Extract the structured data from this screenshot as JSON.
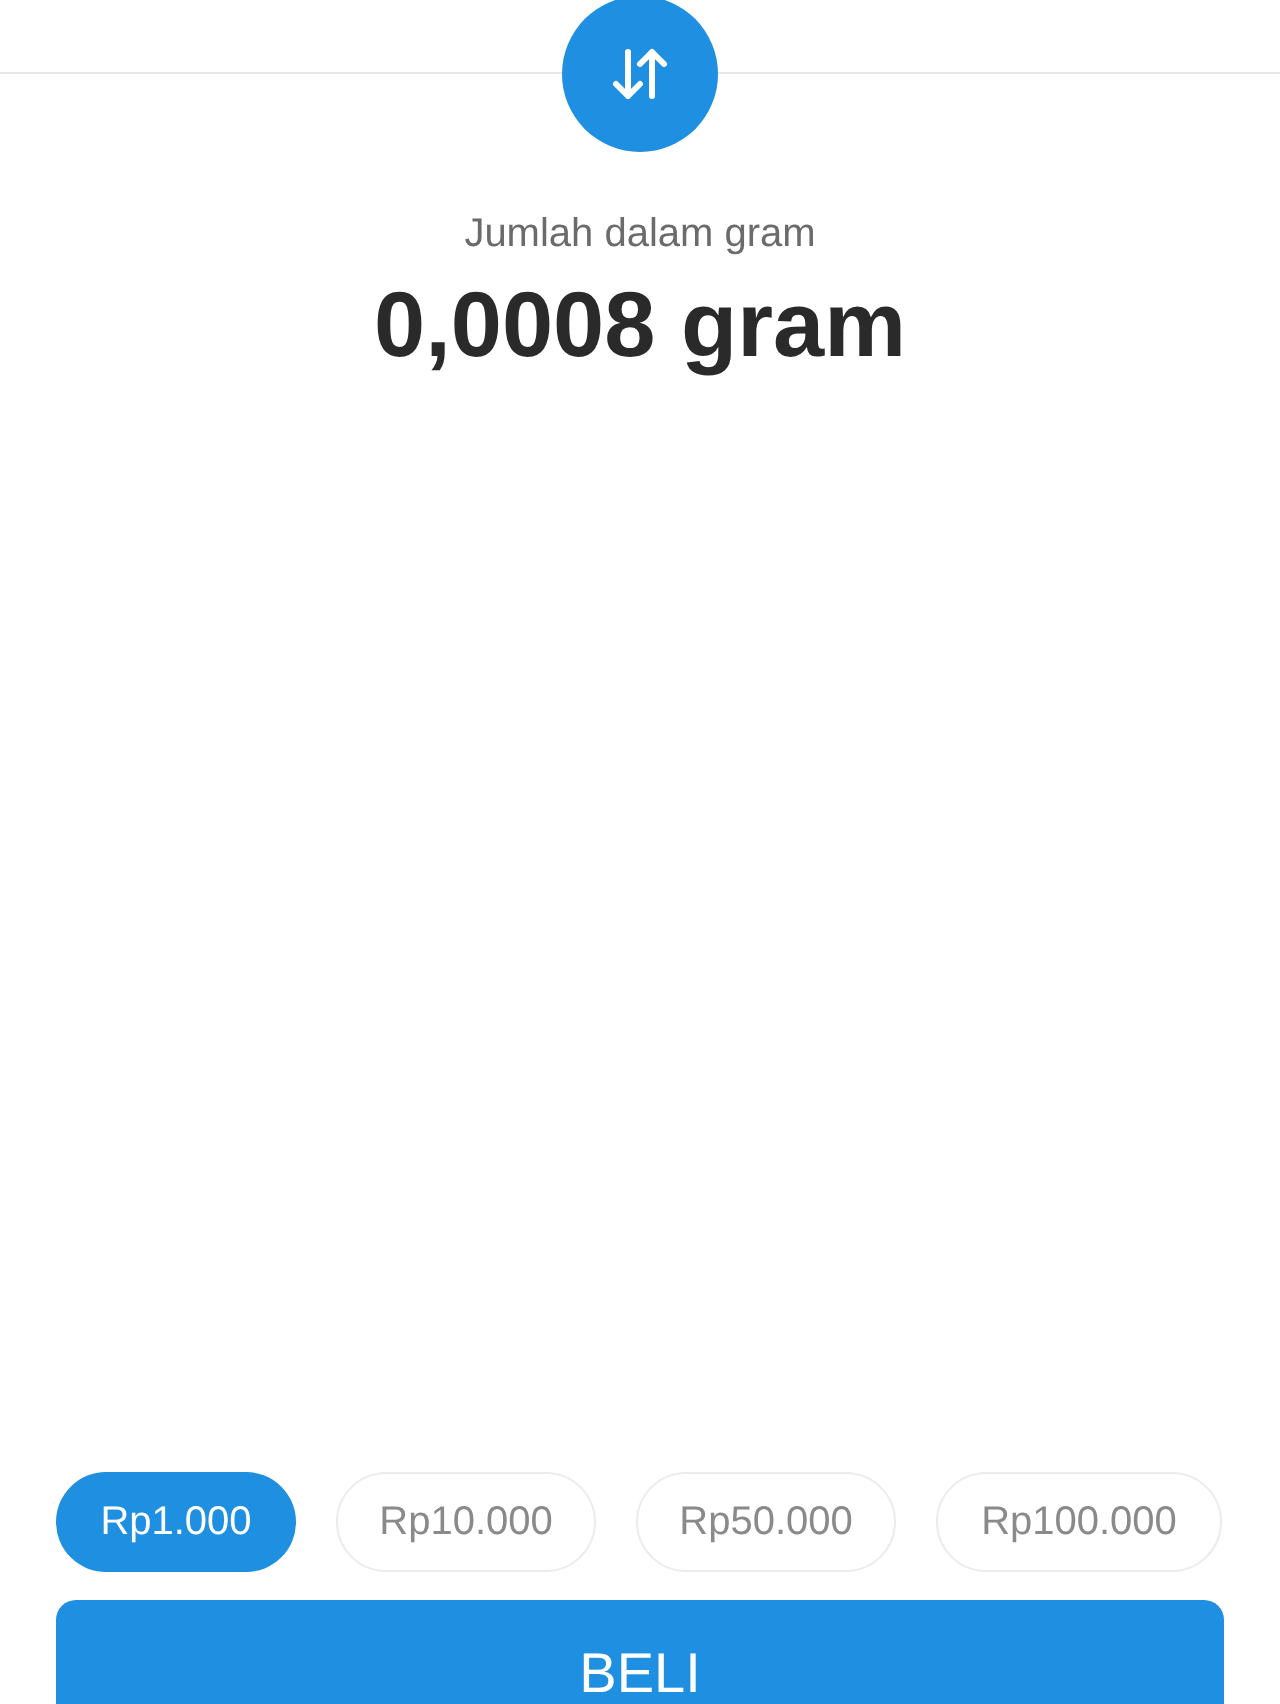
{
  "swap_button": {
    "kind": "swap"
  },
  "amount": {
    "label": "Jumlah dalam gram",
    "value": "0,0008 gram"
  },
  "presets": [
    {
      "label": "Rp1.000",
      "selected": true
    },
    {
      "label": "Rp10.000",
      "selected": false
    },
    {
      "label": "Rp50.000",
      "selected": false
    },
    {
      "label": "Rp100.000",
      "selected": false
    }
  ],
  "buy_button": {
    "label": "BELI"
  }
}
